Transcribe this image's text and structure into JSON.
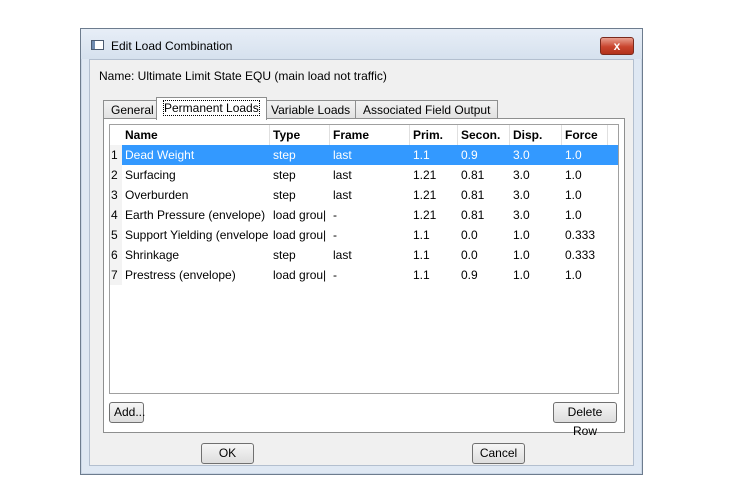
{
  "window": {
    "title": "Edit Load Combination",
    "close_glyph": "x"
  },
  "combination": {
    "name_label": "Name: Ultimate Limit State EQU (main load not traffic)"
  },
  "tabs": [
    {
      "label": "General"
    },
    {
      "label": "Permanent Loads"
    },
    {
      "label": "Variable Loads"
    },
    {
      "label": "Associated Field Output"
    }
  ],
  "table": {
    "columns": [
      "Name",
      "Type",
      "Frame",
      "Prim.",
      "Secon.",
      "Disp.",
      "Force"
    ],
    "rows": [
      {
        "num": "1",
        "name": "Dead Weight",
        "type": "step",
        "frame": "last",
        "prim": "1.1",
        "secon": "0.9",
        "disp": "3.0",
        "force": "1.0"
      },
      {
        "num": "2",
        "name": "Surfacing",
        "type": "step",
        "frame": "last",
        "prim": "1.21",
        "secon": "0.81",
        "disp": "3.0",
        "force": "1.0"
      },
      {
        "num": "3",
        "name": "Overburden",
        "type": "step",
        "frame": "last",
        "prim": "1.21",
        "secon": "0.81",
        "disp": "3.0",
        "force": "1.0"
      },
      {
        "num": "4",
        "name": "Earth Pressure (envelope)",
        "type": "load grou|",
        "frame": "-",
        "prim": "1.21",
        "secon": "0.81",
        "disp": "3.0",
        "force": "1.0"
      },
      {
        "num": "5",
        "name": "Support Yielding (envelope",
        "type": "load grou|",
        "frame": "-",
        "prim": "1.1",
        "secon": "0.0",
        "disp": "1.0",
        "force": "0.333"
      },
      {
        "num": "6",
        "name": "Shrinkage",
        "type": "step",
        "frame": "last",
        "prim": "1.1",
        "secon": "0.0",
        "disp": "1.0",
        "force": "0.333"
      },
      {
        "num": "7",
        "name": "Prestress (envelope)",
        "type": "load grou|",
        "frame": "-",
        "prim": "1.1",
        "secon": "0.9",
        "disp": "1.0",
        "force": "1.0"
      }
    ]
  },
  "buttons": {
    "add": "Add...",
    "delete_row": "Delete Row",
    "ok": "OK",
    "cancel": "Cancel"
  },
  "colors": {
    "selection": "#3399ff",
    "close_button": "#c9452e"
  }
}
